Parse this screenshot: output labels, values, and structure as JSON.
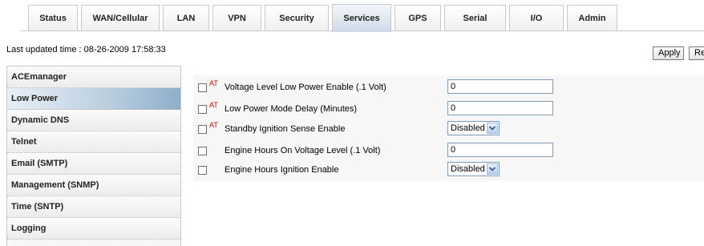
{
  "tabs": [
    {
      "label": "Status",
      "name": "tab-status"
    },
    {
      "label": "WAN/Cellular",
      "name": "tab-wan-cellular"
    },
    {
      "label": "LAN",
      "name": "tab-lan"
    },
    {
      "label": "VPN",
      "name": "tab-vpn"
    },
    {
      "label": "Security",
      "name": "tab-security"
    },
    {
      "label": "Services",
      "name": "tab-services",
      "active": true
    },
    {
      "label": "GPS",
      "name": "tab-gps"
    },
    {
      "label": "Serial",
      "name": "tab-serial"
    },
    {
      "label": "I/O",
      "name": "tab-io"
    },
    {
      "label": "Admin",
      "name": "tab-admin"
    }
  ],
  "status": {
    "last_updated": "Last updated time : 08-26-2009 17:58:33"
  },
  "toolbar": {
    "apply_label": "Apply",
    "refresh_label": "Refresh"
  },
  "sidebar": {
    "items": [
      {
        "label": "ACEmanager"
      },
      {
        "label": "Low Power",
        "active": true
      },
      {
        "label": "Dynamic DNS"
      },
      {
        "label": "Telnet"
      },
      {
        "label": "Email (SMTP)"
      },
      {
        "label": "Management (SNMP)"
      },
      {
        "label": "Time (SNTP)"
      },
      {
        "label": "Logging"
      }
    ]
  },
  "form": {
    "at_marker": "AT",
    "rows": [
      {
        "label": "Voltage Level Low Power Enable (.1 Volt)",
        "at": true,
        "type": "text",
        "value": "0"
      },
      {
        "label": "Low Power Mode Delay (Minutes)",
        "at": true,
        "type": "text",
        "value": "0"
      },
      {
        "label": "Standby Ignition Sense Enable",
        "at": true,
        "type": "select",
        "value": "Disabled"
      },
      {
        "label": "Engine Hours On Voltage Level (.1 Volt)",
        "at": false,
        "type": "text",
        "value": "0"
      },
      {
        "label": "Engine Hours Ignition Enable",
        "at": false,
        "type": "select",
        "value": "Disabled"
      }
    ]
  },
  "colors": {
    "active_tab": "#cfdbe8",
    "active_sidebar": "#8eaecb",
    "at_marker": "#e00000",
    "panel_bg": "#f7f7f7"
  }
}
